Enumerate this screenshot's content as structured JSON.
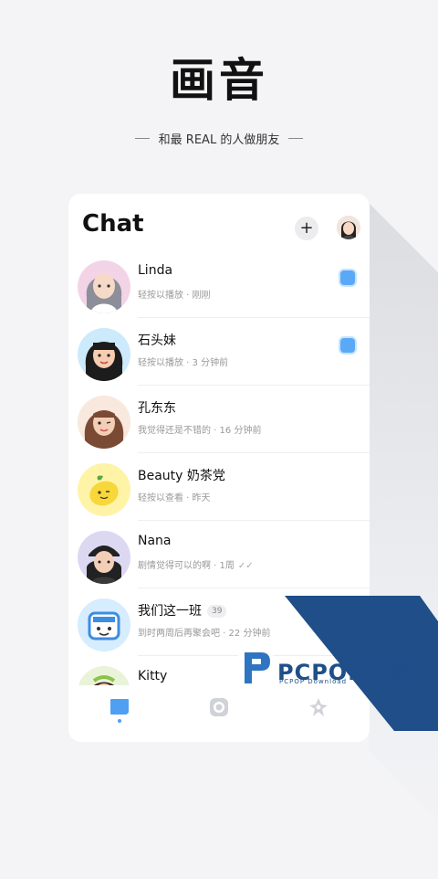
{
  "app": {
    "logo_text": "画音",
    "slogan": "和最 REAL 的人做朋友"
  },
  "header": {
    "title": "Chat",
    "add_label": "+"
  },
  "chats": [
    {
      "name": "Linda",
      "subtitle": "轻按以播放 · 刚刚",
      "unread": true,
      "badge": "",
      "avatar_bg": "#f3d4e6"
    },
    {
      "name": "石头妹",
      "subtitle": "轻按以播放 · 3 分钟前",
      "unread": true,
      "badge": "",
      "avatar_bg": "#cdeafc"
    },
    {
      "name": "孔东东",
      "subtitle": "我觉得还是不错的 · 16 分钟前",
      "unread": false,
      "badge": "",
      "avatar_bg": "#f8e8de"
    },
    {
      "name": "Beauty 奶茶党",
      "subtitle": "轻按以查看 · 昨天",
      "unread": false,
      "badge": "",
      "avatar_bg": "#fff3a8"
    },
    {
      "name": "Nana",
      "subtitle": "剧情觉得可以的啊 · 1周",
      "unread": false,
      "badge": "",
      "avatar_bg": "#ddd8f2"
    },
    {
      "name": "我们这一班",
      "subtitle": "到时两周后再聚会吧 · 22 分钟前",
      "unread": false,
      "badge": "39",
      "avatar_bg": "#d6ecff"
    },
    {
      "name": "Kitty",
      "subtitle": "",
      "unread": false,
      "badge": "",
      "avatar_bg": "#e9f3d8"
    }
  ],
  "tabs": [
    {
      "name": "chat",
      "active": true
    },
    {
      "name": "camera",
      "active": false
    },
    {
      "name": "discover",
      "active": false
    }
  ],
  "watermark": {
    "text": "PCPOP下载",
    "sub": "PCPOP Download"
  },
  "colors": {
    "accent": "#4f9ff2",
    "watermark": "#1e4f8a"
  }
}
